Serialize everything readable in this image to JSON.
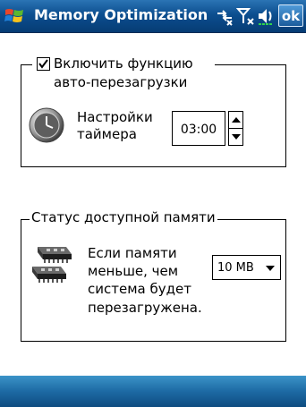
{
  "titlebar": {
    "title": "Memory Optimization",
    "ok_label": "ok"
  },
  "icons": {
    "start": "windows-flag-icon",
    "connectivity": "connectivity-icon",
    "signal": "signal-icon",
    "volume": "volume-icon",
    "clock": "clock-icon",
    "memory": "memory-chip-icon"
  },
  "auto_restart": {
    "checkbox_label_line1": "Включить функцию",
    "checkbox_label_line2": "авто-перезагрузки",
    "checked": true,
    "timer_label_line1": "Настройки",
    "timer_label_line2": "таймера",
    "timer_value": "03:00"
  },
  "memory_status": {
    "legend": "Статус доступной памяти",
    "description_lines": [
      "Если памяти",
      "меньше, чем",
      "система будет",
      "перезагружена."
    ],
    "threshold_value": "10 MB"
  },
  "colors": {
    "titlebar": "#0c4e8f",
    "bottombar": "#1d6aa4"
  }
}
